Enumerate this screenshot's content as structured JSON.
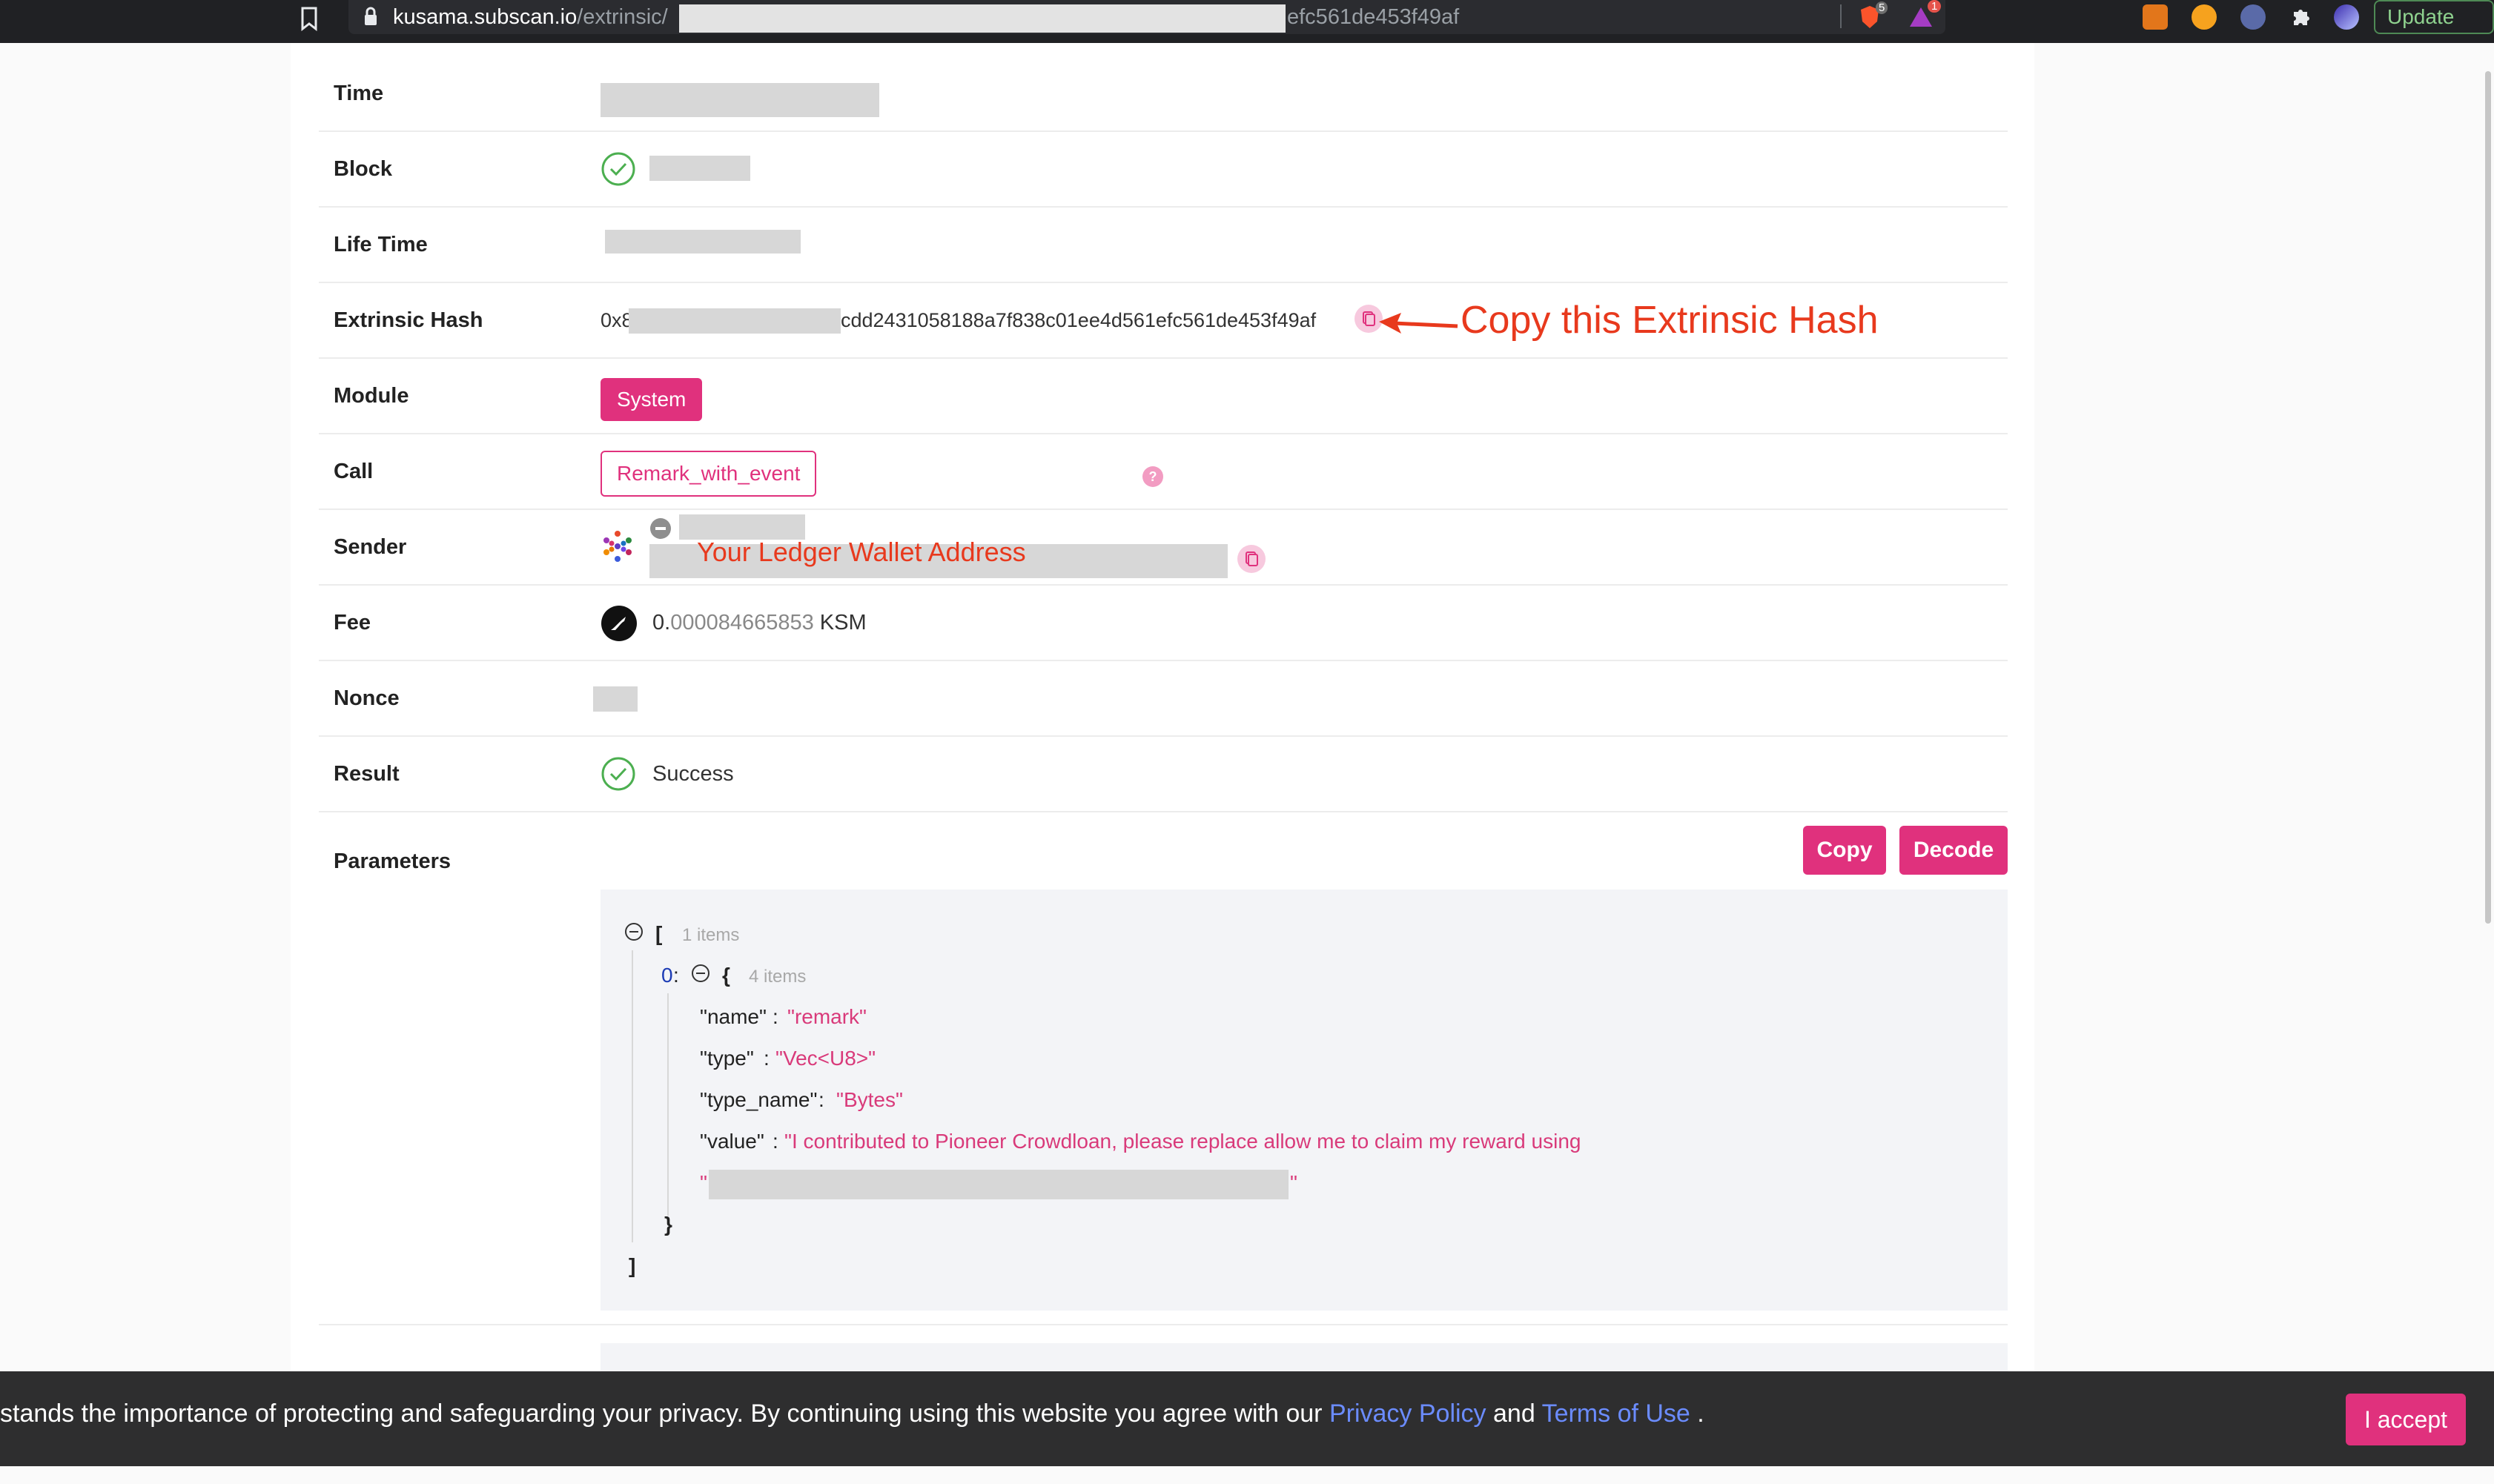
{
  "browser": {
    "url_host": "kusama.subscan.io",
    "url_path": "/extrinsic/",
    "url_tail": "efc561de453f49af",
    "brave_shield_count": "5",
    "rewards_count": "1",
    "update_label": "Update"
  },
  "rows": {
    "time_label": "Time",
    "block_label": "Block",
    "lifetime_label": "Life Time",
    "hash_label": "Extrinsic Hash",
    "hash_prefix": "0x8",
    "hash_suffix": "cdd2431058188a7f838c01ee4d561efc561de453f49af",
    "module_label": "Module",
    "module_value": "System",
    "call_label": "Call",
    "call_value": "Remark_with_event",
    "sender_label": "Sender",
    "fee_label": "Fee",
    "fee_int": "0.",
    "fee_dec": "000084665853",
    "fee_unit": " KSM",
    "nonce_label": "Nonce",
    "result_label": "Result",
    "result_value": "Success",
    "params_label": "Parameters"
  },
  "annotations": {
    "copy_hash": "Copy this Extrinsic Hash",
    "wallet": "Your Ledger Wallet Address"
  },
  "params": {
    "copy_label": "Copy",
    "decode_label": "Decode",
    "open_bracket": "[",
    "close_bracket": "]",
    "root_meta": "1 items",
    "index": "0",
    "colon": " :",
    "open_brace": "{",
    "close_brace": "}",
    "item_meta": "4 items",
    "fields": [
      {
        "key": "\"name\"",
        "value": "\"remark\""
      },
      {
        "key": "\"type\"",
        "value": "\"Vec<U8>\""
      },
      {
        "key": "\"type_name\"",
        "value": "\"Bytes\""
      },
      {
        "key": "\"value\"",
        "value": "\"I contributed to Pioneer Crowdloan, please replace allow me to claim my reward using"
      }
    ],
    "value_cont_open": "\"",
    "value_cont_close": "\""
  },
  "cookie": {
    "text_before": "stands the importance of protecting and safeguarding your privacy. By continuing using this website you agree with our ",
    "privacy_link": "Privacy Policy",
    "and": " and ",
    "terms_link": "Terms of Use",
    "period": " .",
    "accept_label": "I accept"
  },
  "colors": {
    "brand": "#e0317d",
    "success": "#4caf50",
    "annotation": "#e8391d",
    "link": "#6b8cff"
  }
}
